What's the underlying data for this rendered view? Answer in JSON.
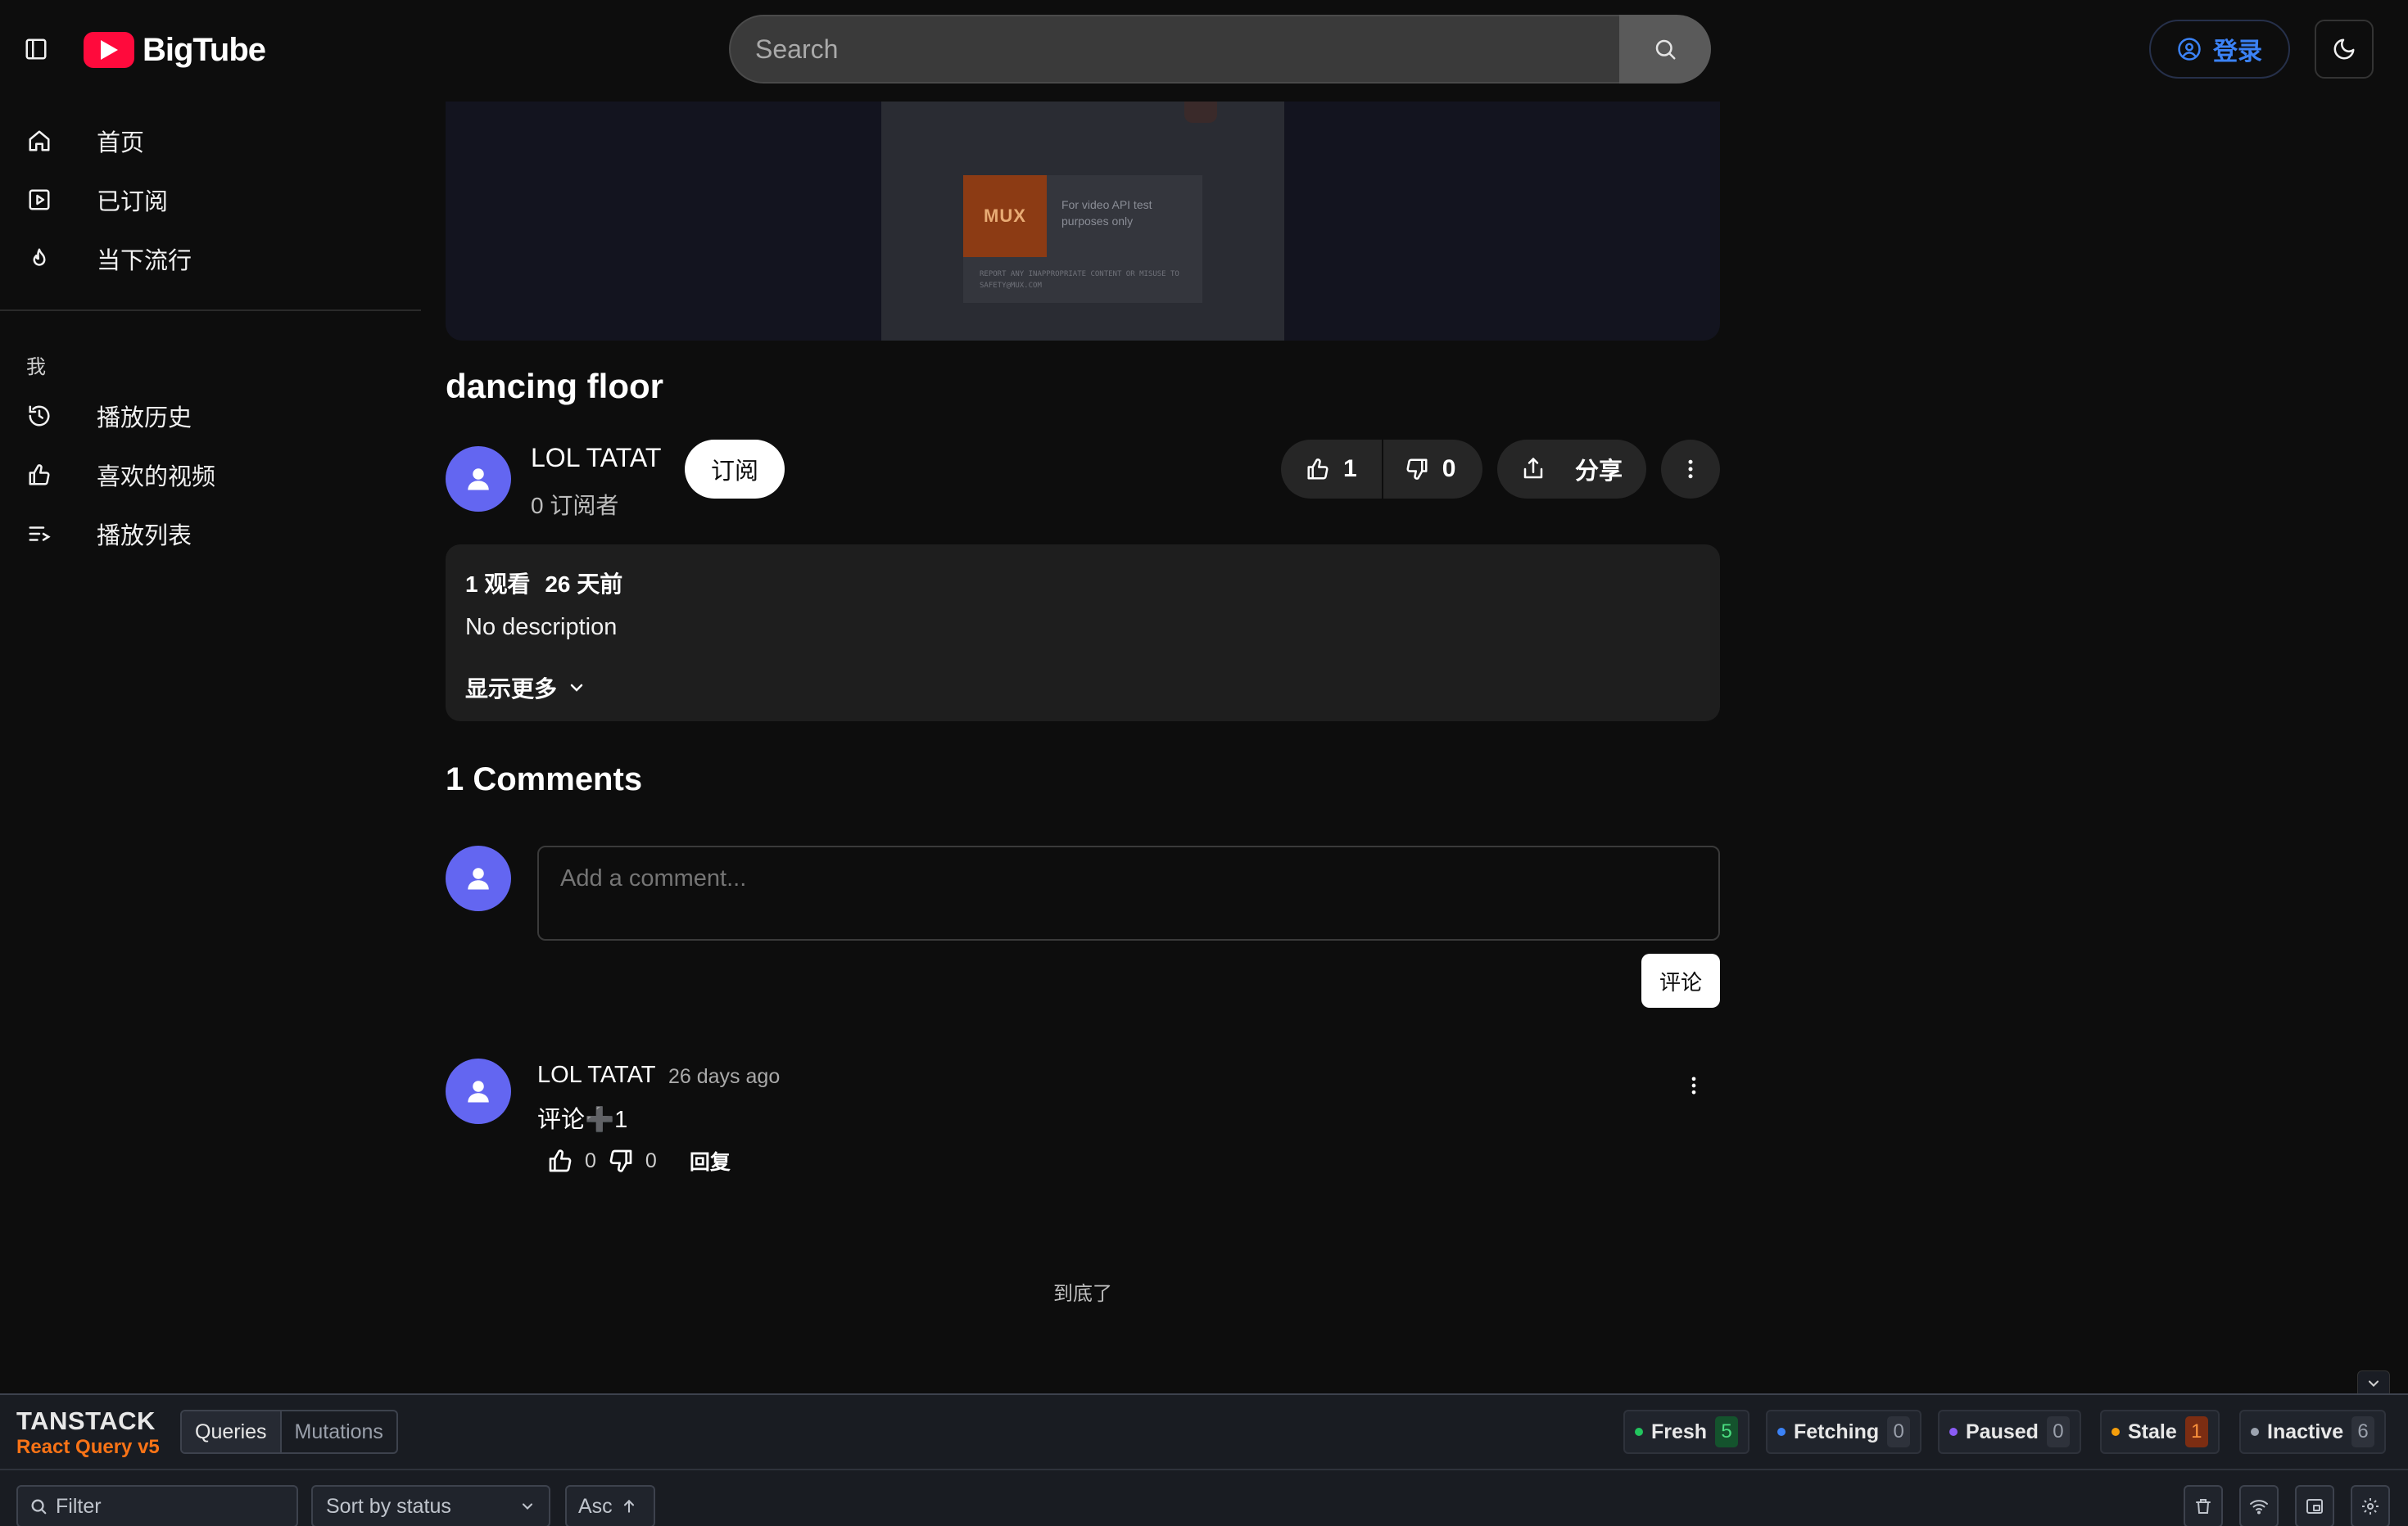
{
  "header": {
    "logo_text": "BigTube",
    "search_placeholder": "Search",
    "login_label": "登录"
  },
  "sidebar": {
    "main_items": [
      {
        "label": "首页",
        "icon": "home-icon"
      },
      {
        "label": "已订阅",
        "icon": "subscriptions-icon"
      },
      {
        "label": "当下流行",
        "icon": "flame-icon"
      }
    ],
    "section_title": "我",
    "me_items": [
      {
        "label": "播放历史",
        "icon": "history-icon"
      },
      {
        "label": "喜欢的视频",
        "icon": "thumbs-up-icon"
      },
      {
        "label": "播放列表",
        "icon": "playlist-icon"
      }
    ]
  },
  "video": {
    "thumbnail_brand": "MUX",
    "thumbnail_caption": "For video API test purposes only",
    "thumbnail_footer": "REPORT ANY INAPPROPRIATE CONTENT OR MISUSE TO SAFETY@MUX.COM",
    "title": "dancing floor",
    "channel_name": "LOL TATAT",
    "subscriber_count": "0 订阅者",
    "subscribe_label": "订阅",
    "likes": "1",
    "dislikes": "0",
    "share_label": "分享",
    "views": "1 观看",
    "published": "26 天前",
    "description": "No description",
    "show_more_label": "显示更多"
  },
  "comments": {
    "heading": "1 Comments",
    "input_placeholder": "Add a comment...",
    "submit_label": "评论",
    "items": [
      {
        "author": "LOL TATAT",
        "time": "26 days ago",
        "body": "评论➕1",
        "likes": "0",
        "dislikes": "0",
        "reply_label": "回复"
      }
    ],
    "end_text": "到底了"
  },
  "devtools": {
    "brand_top": "TANSTACK",
    "brand_bottom": "React Query v5",
    "tabs": [
      "Queries",
      "Mutations"
    ],
    "statuses": [
      {
        "label": "Fresh",
        "count": "5",
        "color": "#22c55e"
      },
      {
        "label": "Fetching",
        "count": "0",
        "color": "#3b82f6"
      },
      {
        "label": "Paused",
        "count": "0",
        "color": "#8b5cf6"
      },
      {
        "label": "Stale",
        "count": "1",
        "color": "#f59e0b"
      },
      {
        "label": "Inactive",
        "count": "6",
        "color": "#9ca3af"
      }
    ],
    "filter_placeholder": "Filter",
    "sort_label": "Sort by status",
    "order_label": "Asc"
  },
  "colors": {
    "brand_red": "#ff0a3c",
    "avatar": "#6366f1",
    "link_blue": "#3b82f6",
    "devtools_accent": "#f97316"
  }
}
